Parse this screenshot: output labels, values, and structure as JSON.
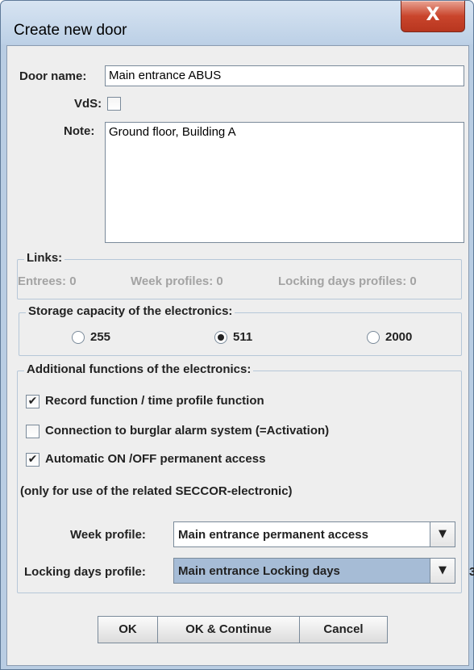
{
  "window": {
    "title": "Create new door",
    "close_glyph": "X"
  },
  "form": {
    "door_name_label": "Door name:",
    "door_name_value": "Main entrance ABUS",
    "vds_label": "VdS:",
    "vds_checked": false,
    "note_label": "Note:",
    "note_value": "Ground floor, Building A"
  },
  "links": {
    "title": "Links:",
    "entrees": "Entrees: 0",
    "week_profiles": "Week profiles: 0",
    "locking_days_profiles": "Locking days profiles: 0"
  },
  "storage": {
    "title": "Storage capacity of the electronics:",
    "options": [
      "255",
      "511",
      "2000"
    ],
    "selected": "511"
  },
  "additional": {
    "title": "Additional functions of the electronics:",
    "options": [
      {
        "label": "Record function / time profile function",
        "checked": true
      },
      {
        "label": "Connection to burglar alarm system (=Activation)",
        "checked": false
      },
      {
        "label": "Automatic ON /OFF permanent access",
        "checked": true
      }
    ],
    "note": "(only for use of the related SECCOR-electronic)",
    "week_profile_label": "Week profile:",
    "week_profile_value": "Main entrance permanent access",
    "locking_days_label": "Locking days profile:",
    "locking_days_value": "Main entrance Locking days"
  },
  "buttons": {
    "ok": "OK",
    "ok_continue": "OK & Continue",
    "cancel": "Cancel"
  },
  "stray_text": "3",
  "icons": {
    "checkmark": "✔",
    "dropdown": "▼"
  }
}
